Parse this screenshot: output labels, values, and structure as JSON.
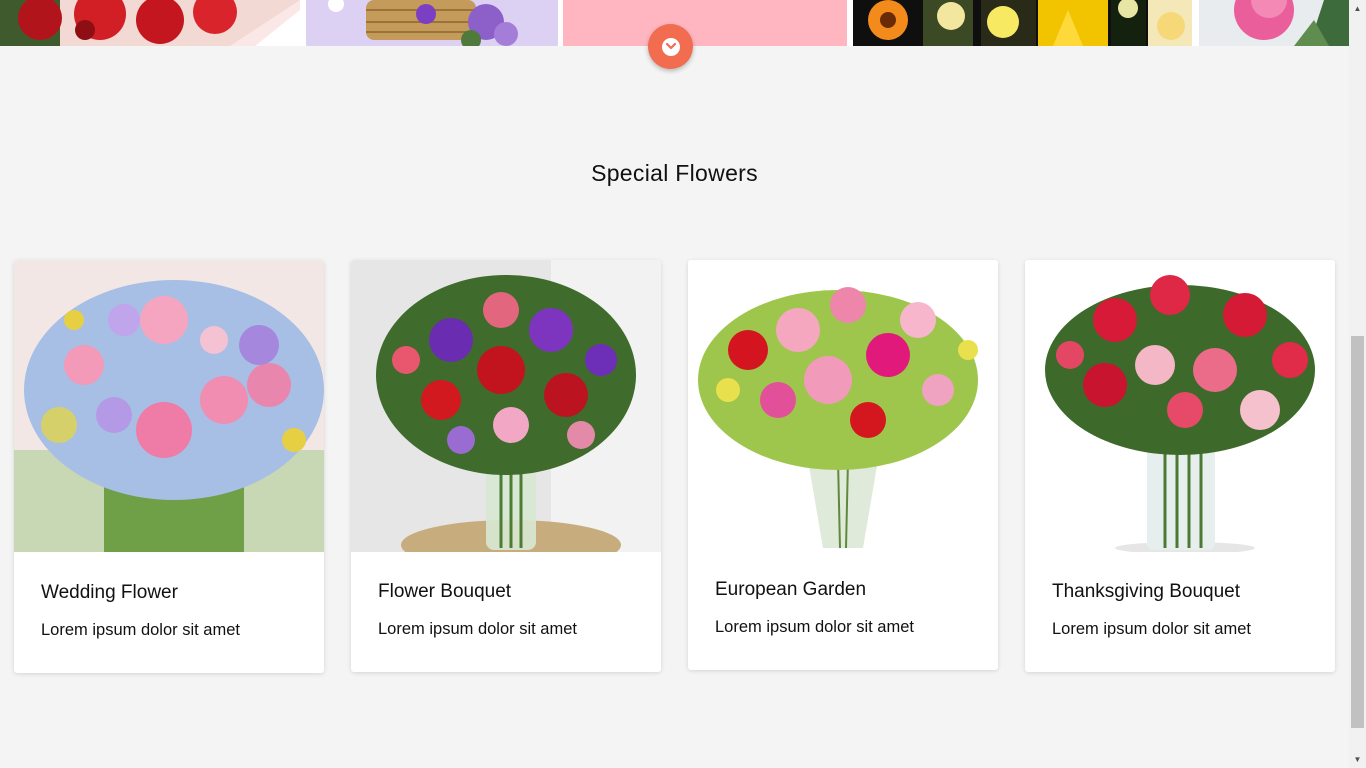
{
  "hero": {
    "tiles": [
      {
        "icon": "roses-image"
      },
      {
        "icon": "flower-basket-image"
      },
      {
        "icon": "pink-banner-image"
      },
      {
        "icon": "flower-collage-image"
      },
      {
        "icon": "peony-image"
      }
    ],
    "scroll_button_icon": "chevron-down-icon",
    "accent_color": "#f26c4f"
  },
  "section": {
    "title": "Special Flowers",
    "cards": [
      {
        "name": "Wedding Flower",
        "description": "Lorem ipsum dolor sit amet",
        "image": "wedding-flower-image"
      },
      {
        "name": "Flower Bouquet",
        "description": "Lorem ipsum dolor sit amet",
        "image": "flower-bouquet-image"
      },
      {
        "name": "European Garden",
        "description": "Lorem ipsum dolor sit amet",
        "image": "european-garden-image"
      },
      {
        "name": "Thanksgiving Bouquet",
        "description": "Lorem ipsum dolor sit amet",
        "image": "thanksgiving-bouquet-image"
      }
    ]
  },
  "colors": {
    "page_background": "#f4f4f4",
    "card_background": "#ffffff",
    "text": "#111111"
  }
}
